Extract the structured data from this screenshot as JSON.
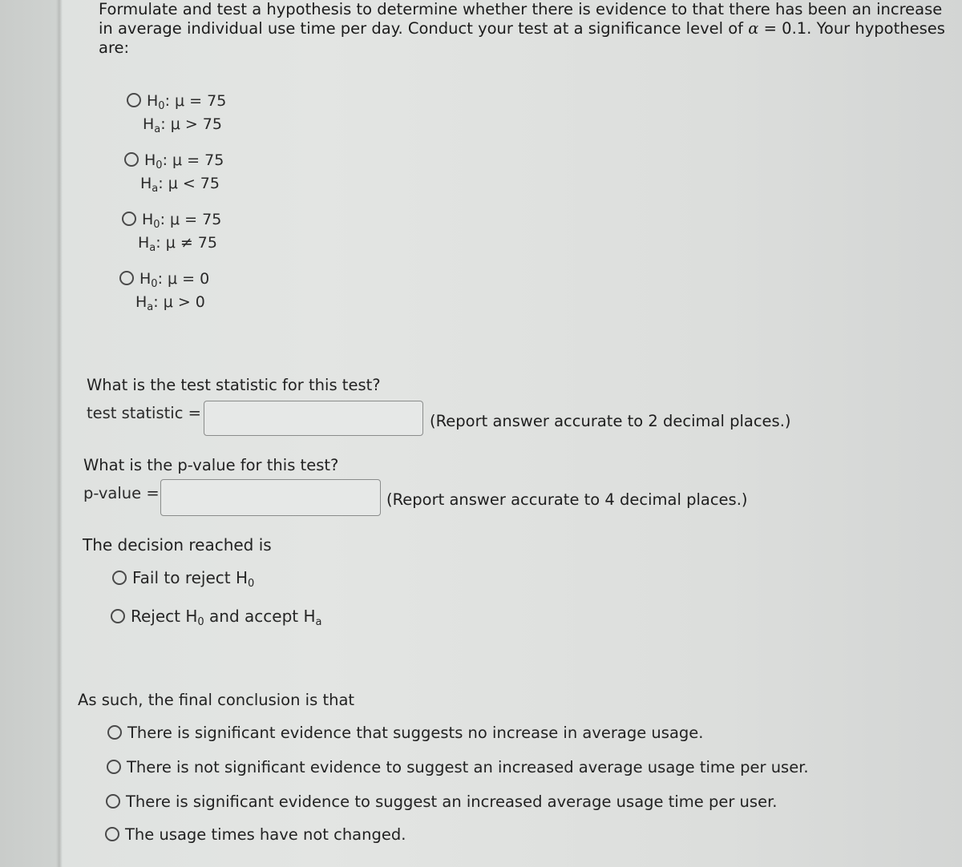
{
  "intro": {
    "text_before_alpha": "Formulate and test a hypothesis to determine whether there is evidence to that there has been an increase in average individual use time per day. Conduct your test at a significance level of ",
    "alpha_symbol": "α",
    "alpha_rest": " = 0.1. Your hypotheses are:"
  },
  "hypotheses": [
    {
      "h0_label": "H",
      "h0_sub": "0",
      "h0_rest": ": μ = 75",
      "ha_label": "H",
      "ha_sub": "a",
      "ha_rest": ": μ > 75",
      "selected": false
    },
    {
      "h0_label": "H",
      "h0_sub": "0",
      "h0_rest": ": μ = 75",
      "ha_label": "H",
      "ha_sub": "a",
      "ha_rest": ": μ < 75",
      "selected": false
    },
    {
      "h0_label": "H",
      "h0_sub": "0",
      "h0_rest": ": μ = 75",
      "ha_label": "H",
      "ha_sub": "a",
      "ha_rest": ": μ ≠ 75",
      "selected": false
    },
    {
      "h0_label": "H",
      "h0_sub": "0",
      "h0_rest": ": μ = 0",
      "ha_label": "H",
      "ha_sub": "a",
      "ha_rest": ": μ > 0",
      "selected": false
    }
  ],
  "test_statistic": {
    "question": "What is the test statistic for this test?",
    "label": "test statistic =",
    "value": "",
    "note": "(Report answer accurate to 2 decimal places.)"
  },
  "p_value": {
    "question": "What is the p-value for this test?",
    "label": "p-value =",
    "value": "",
    "note": "(Report answer accurate to 4 decimal places.)"
  },
  "decision": {
    "question": "The decision reached is",
    "options": [
      {
        "text": "Fail to reject H",
        "sub": "0",
        "text2": "",
        "sub2": "",
        "selected": false
      },
      {
        "text": "Reject H",
        "sub": "0",
        "text2": " and accept H",
        "sub2": "a",
        "selected": false
      }
    ]
  },
  "conclusion": {
    "question": "As such, the final conclusion is that",
    "options": [
      {
        "text": "There is significant evidence that suggests no increase in average usage.",
        "selected": false
      },
      {
        "text": "There is not significant evidence to suggest an increased average usage time per user.",
        "selected": false
      },
      {
        "text": "There is significant evidence to suggest an increased average usage time per user.",
        "selected": false
      },
      {
        "text": "The usage times have not changed.",
        "selected": false
      }
    ]
  }
}
